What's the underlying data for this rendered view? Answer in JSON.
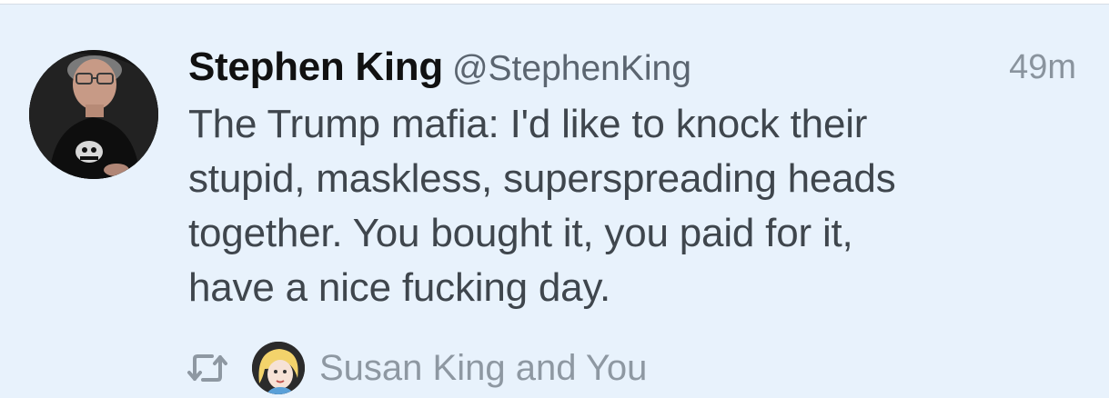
{
  "tweet": {
    "display_name": "Stephen King",
    "handle": "@StephenKing",
    "timestamp": "49m",
    "text_lines": [
      "The Trump mafia: I'd like to knock their",
      "stupid, maskless, superspreading heads",
      "together. You bought it, you paid for it,",
      "have a nice fucking day."
    ],
    "avatar_icon": "profile-photo",
    "footer": {
      "retweet_icon": "retweet-icon",
      "retweeted_by": "Susan King and You"
    }
  },
  "colors": {
    "background": "#e8f2fc",
    "retweet_icon": "#8e98a2",
    "name": "#111111",
    "body_text": "#3f464d"
  }
}
